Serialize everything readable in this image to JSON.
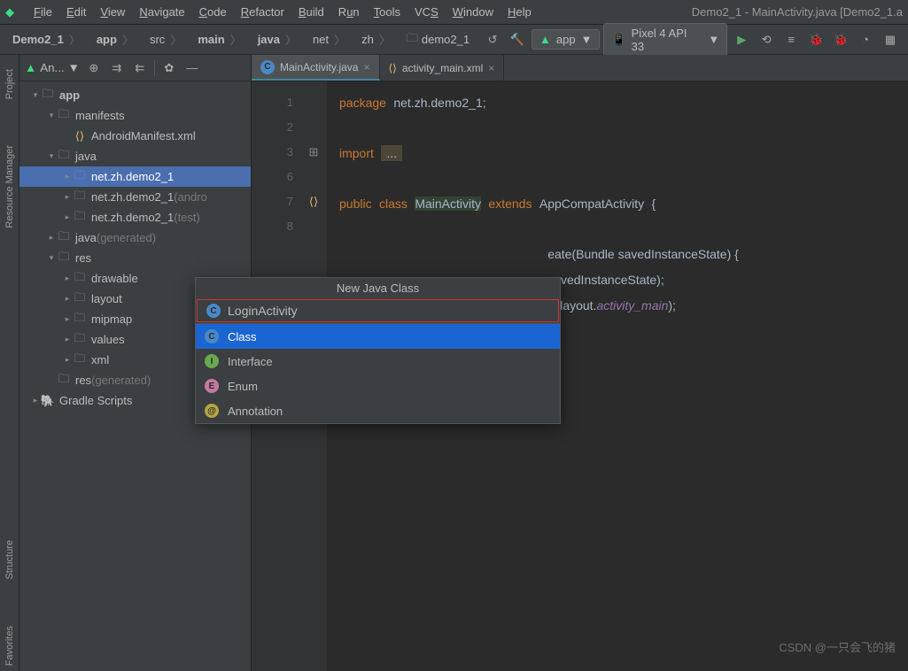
{
  "window_title": "Demo2_1 - MainActivity.java [Demo2_1.a",
  "menu": [
    "File",
    "Edit",
    "View",
    "Navigate",
    "Code",
    "Refactor",
    "Build",
    "Run",
    "Tools",
    "VCS",
    "Window",
    "Help"
  ],
  "breadcrumbs": [
    "Demo2_1",
    "app",
    "src",
    "main",
    "java",
    "net",
    "zh",
    "demo2_1"
  ],
  "run_config": "app",
  "device": "Pixel 4 API 33",
  "sidebar": {
    "view_label": "An...",
    "tree": [
      {
        "depth": 0,
        "arrow": "▾",
        "icon": "module",
        "label": "app",
        "bold": true
      },
      {
        "depth": 1,
        "arrow": "▾",
        "icon": "folder",
        "label": "manifests"
      },
      {
        "depth": 2,
        "arrow": "",
        "icon": "xml",
        "label": "AndroidManifest.xml"
      },
      {
        "depth": 1,
        "arrow": "▾",
        "icon": "folder",
        "label": "java"
      },
      {
        "depth": 2,
        "arrow": "▸",
        "icon": "pkg",
        "label": "net.zh.demo2_1",
        "selected": true
      },
      {
        "depth": 2,
        "arrow": "▸",
        "icon": "pkg",
        "label": "net.zh.demo2_1",
        "dim": " (andro"
      },
      {
        "depth": 2,
        "arrow": "▸",
        "icon": "pkg",
        "label": "net.zh.demo2_1",
        "dim": " (test)"
      },
      {
        "depth": 1,
        "arrow": "▸",
        "icon": "genfolder",
        "label": "java",
        "dim": " (generated)"
      },
      {
        "depth": 1,
        "arrow": "▾",
        "icon": "folder",
        "label": "res"
      },
      {
        "depth": 2,
        "arrow": "▸",
        "icon": "folder",
        "label": "drawable"
      },
      {
        "depth": 2,
        "arrow": "▸",
        "icon": "folder",
        "label": "layout"
      },
      {
        "depth": 2,
        "arrow": "▸",
        "icon": "folder",
        "label": "mipmap"
      },
      {
        "depth": 2,
        "arrow": "▸",
        "icon": "folder",
        "label": "values"
      },
      {
        "depth": 2,
        "arrow": "▸",
        "icon": "folder",
        "label": "xml"
      },
      {
        "depth": 1,
        "arrow": "",
        "icon": "genfolder",
        "label": "res",
        "dim": " (generated)"
      },
      {
        "depth": 0,
        "arrow": "▸",
        "icon": "gradle",
        "label": "Gradle Scripts"
      }
    ]
  },
  "left_tools": [
    "Project",
    "Resource Manager",
    "Structure",
    "Favorites"
  ],
  "tabs": [
    {
      "icon": "class",
      "label": "MainActivity.java",
      "active": true
    },
    {
      "icon": "xml",
      "label": "activity_main.xml",
      "active": false
    }
  ],
  "code_lines": [
    "1",
    "2",
    "3",
    "6",
    "7",
    "8",
    "",
    "",
    "",
    "",
    ""
  ],
  "code": {
    "package_kw": "package",
    "package_name": "net.zh.demo2_1;",
    "import_kw": "import",
    "import_rest": "...",
    "public_kw": "public",
    "class_kw": "class",
    "class_name": "MainActivity",
    "extends_kw": "extends",
    "super_name": "AppCompatActivity",
    "brace_open": "{",
    "oncreate_sig_1": "eate(Bundle savedInstanceState) {",
    "super_call": "savedInstanceState);",
    "setcv_1": "R.layout.",
    "setcv_2": "activity_main",
    "setcv_3": ");"
  },
  "popup": {
    "title": "New Java Class",
    "input": "LoginActivity",
    "items": [
      {
        "icon": "class",
        "label": "Class",
        "selected": true
      },
      {
        "icon": "iface",
        "label": "Interface"
      },
      {
        "icon": "enum",
        "label": "Enum"
      },
      {
        "icon": "anno",
        "label": "Annotation"
      }
    ]
  },
  "watermark": "CSDN @一只会飞的猪"
}
